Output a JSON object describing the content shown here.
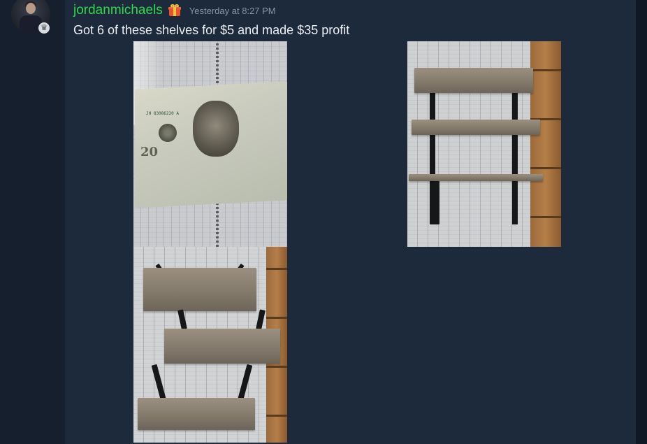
{
  "message": {
    "username": "jordanmichaels",
    "timestamp": "Yesterday at 8:27 PM",
    "text": "Got 6 of these shelves for $5 and made $35 profit",
    "colors": {
      "username": "#2fd84c",
      "text": "#eceff3",
      "timestamp": "#8b93a1",
      "background": "#1d2a3b"
    },
    "avatar": {
      "icon": "user-avatar",
      "badge_icon": "crown-icon",
      "badge_glyph": "♛"
    },
    "badge_icon": "gift-icon",
    "attachments": [
      {
        "name": "cash-photo",
        "subject": "twenty-dollar-bill-on-tablecloth"
      },
      {
        "name": "shelves-stacked-photo",
        "subject": "three-wooden-shelves-stacked"
      },
      {
        "name": "shelves-spread-photo",
        "subject": "three-wooden-shelves-spread"
      }
    ]
  },
  "bill": {
    "serial": "JH 83086220 A",
    "denomination": "20"
  }
}
